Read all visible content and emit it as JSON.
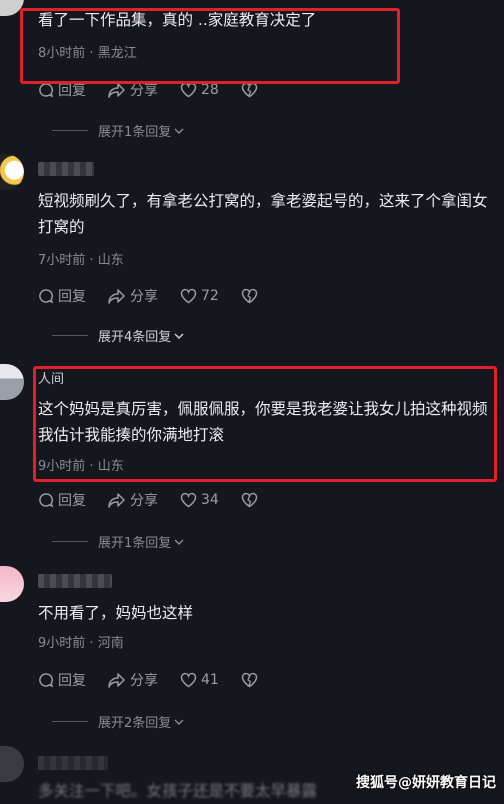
{
  "comments": [
    {
      "text": "看了一下作品集，真的 ..家庭教育决定了",
      "time": "8小时前",
      "location": "黑龙江",
      "reply": "回复",
      "share": "分享",
      "likes": "28",
      "expand": "展开1条回复"
    },
    {
      "text": "短视频刷久了，有拿老公打窝的，拿老婆起号的，这来了个拿闺女打窝的",
      "time": "7小时前",
      "location": "山东",
      "reply": "回复",
      "share": "分享",
      "likes": "72",
      "expand": "展开4条回复"
    },
    {
      "user_partial": "人间",
      "text": "这个妈妈是真厉害，佩服佩服，你要是我老婆让我女儿拍这种视频我估计我能揍的你满地打滚",
      "time": "9小时前",
      "location": "山东",
      "reply": "回复",
      "share": "分享",
      "likes": "34",
      "expand": "展开1条回复"
    },
    {
      "text": "不用看了，妈妈也这样",
      "time": "9小时前",
      "location": "河南",
      "reply": "回复",
      "share": "分享",
      "likes": "41",
      "expand": "展开2条回复"
    },
    {
      "text": "多关注一下吧。女孩子还是不要太早暴露"
    }
  ],
  "separator": " · ",
  "watermark": "搜狐号@妍妍教育日记"
}
